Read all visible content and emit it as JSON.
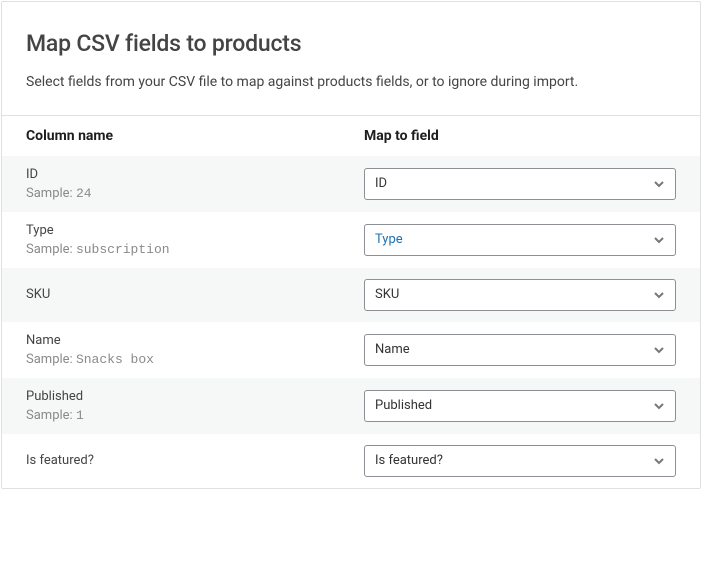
{
  "header": {
    "title": "Map CSV fields to products",
    "subtitle": "Select fields from your CSV file to map against products fields, or to ignore during import."
  },
  "table": {
    "col1": "Column name",
    "col2": "Map to field",
    "sample_label": "Sample:"
  },
  "rows": [
    {
      "name": "ID",
      "sample": "24",
      "mapped": "ID",
      "highlighted": false,
      "has_sample": true
    },
    {
      "name": "Type",
      "sample": "subscription",
      "mapped": "Type",
      "highlighted": true,
      "has_sample": true
    },
    {
      "name": "SKU",
      "sample": "",
      "mapped": "SKU",
      "highlighted": false,
      "has_sample": false
    },
    {
      "name": "Name",
      "sample": "Snacks box",
      "mapped": "Name",
      "highlighted": false,
      "has_sample": true
    },
    {
      "name": "Published",
      "sample": "1",
      "mapped": "Published",
      "highlighted": false,
      "has_sample": true
    },
    {
      "name": "Is featured?",
      "sample": "",
      "mapped": "Is featured?",
      "highlighted": false,
      "has_sample": false
    }
  ]
}
